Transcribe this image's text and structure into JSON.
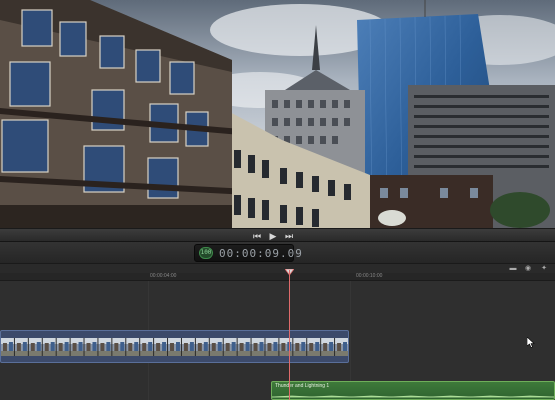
{
  "viewer": {
    "scene": "city-buildings-photo"
  },
  "transport": {
    "rewind_icon": "skip-back-icon",
    "play_icon": "play-icon",
    "forward_icon": "skip-forward-icon"
  },
  "timecode": {
    "badge": "100",
    "value": "00:00:09.09"
  },
  "ruler": {
    "labels": [
      "00:00:04:00",
      "00:00:10:00"
    ]
  },
  "tracks": {
    "audio_clip_label": "Thunder and Lightning 1"
  },
  "colors": {
    "playhead": "#e06b6b",
    "audio_clip": "#3e7a3a",
    "video_clip": "#3c4a6a"
  }
}
